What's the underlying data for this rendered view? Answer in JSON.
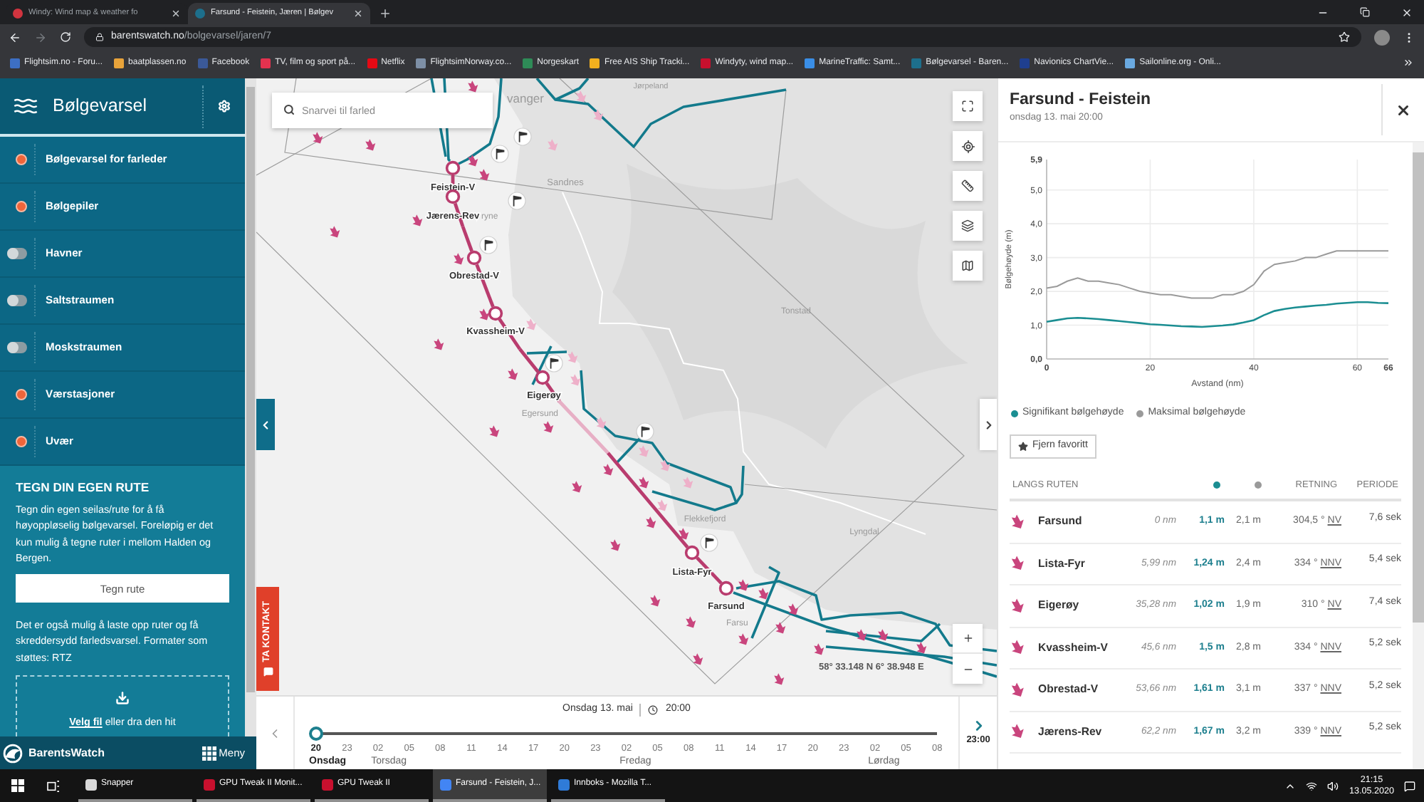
{
  "browser": {
    "tabs": [
      {
        "title": "Windy: Wind map & weather fo",
        "selected": false,
        "color": "#d1343f"
      },
      {
        "title": "Farsund - Feistein, Jæren | Bølgev",
        "selected": true,
        "color": "#1d6f8c"
      }
    ],
    "url": {
      "host": "barentswatch.no",
      "path": "/bolgevarsel/jaren/7"
    },
    "bookmarks": [
      {
        "label": "Flightsim.no - Foru...",
        "color": "#3d6fc4"
      },
      {
        "label": "baatplassen.no",
        "color": "#e8a33a"
      },
      {
        "label": "Facebook",
        "color": "#3b5998"
      },
      {
        "label": "TV, film og sport på...",
        "color": "#e3324f"
      },
      {
        "label": "Netflix",
        "color": "#e50914"
      },
      {
        "label": "FlightsimNorway.co...",
        "color": "#7d8fa6"
      },
      {
        "label": "Norgeskart",
        "color": "#2e8b57"
      },
      {
        "label": "Free AIS Ship Tracki...",
        "color": "#f2b01e"
      },
      {
        "label": "Windyty, wind map...",
        "color": "#c8102e"
      },
      {
        "label": "MarineTraffic: Samt...",
        "color": "#3a8ee6"
      },
      {
        "label": "Bølgevarsel - Baren...",
        "color": "#1d6f8c"
      },
      {
        "label": "Navionics ChartVie...",
        "color": "#1f3f8f"
      },
      {
        "label": "Sailonline.org - Onli...",
        "color": "#6aa9e0"
      }
    ]
  },
  "sidebar": {
    "title": "Bølgevarsel",
    "layers": [
      {
        "label": "Bølgevarsel for farleder",
        "on": true
      },
      {
        "label": "Bølgepiler",
        "on": true
      },
      {
        "label": "Havner",
        "on": false
      },
      {
        "label": "Saltstraumen",
        "on": false
      },
      {
        "label": "Moskstraumen",
        "on": false
      },
      {
        "label": "Værstasjoner",
        "on": true
      },
      {
        "label": "Uvær",
        "on": true
      }
    ],
    "route": {
      "heading": "TEGN DIN EGEN RUTE",
      "text": "Tegn din egen seilas/rute for å få høyoppløselig bølgevarsel. Foreløpig er det kun mulig å tegne ruter i mellom Halden og Bergen.",
      "button": "Tegn rute",
      "upload_text": "Det er også mulig å laste opp ruter og få skreddersydd farledsvarsel. Formater som støttes: RTZ",
      "drop": {
        "link": "Velg fil",
        "text": "eller dra den hit"
      }
    },
    "footer": {
      "brand": "BarentsWatch",
      "menu": "Meny"
    }
  },
  "map": {
    "search_placeholder": "Snarvei til farled",
    "places": [
      {
        "name": "Jørpeland"
      },
      {
        "name": "vanger"
      },
      {
        "name": "Sandnes"
      },
      {
        "name": "ryne"
      },
      {
        "name": "Tonstad"
      },
      {
        "name": "Egersund"
      },
      {
        "name": "Flekkefjord"
      },
      {
        "name": "Lyngdal"
      },
      {
        "name": "Farsu"
      }
    ],
    "stations": [
      {
        "name": "Feistein-V"
      },
      {
        "name": "Jærens-Rev"
      },
      {
        "name": "Obrestad-V"
      },
      {
        "name": "Kvassheim-V"
      },
      {
        "name": "Eigerøy"
      },
      {
        "name": "Lista-Fyr"
      },
      {
        "name": "Farsund"
      }
    ],
    "coordinates": "58° 33.148 N 6° 38.948 E",
    "contact": "TA KONTAKT"
  },
  "timeline": {
    "date": "Onsdag 13. mai",
    "time": "20:00",
    "level": 0,
    "hours": [
      {
        "label": "20",
        "day": "Onsdag",
        "selected": true
      },
      {
        "label": "23",
        "selected": false
      },
      {
        "label": "02",
        "day": "Torsdag",
        "selected": false
      },
      {
        "label": "05",
        "selected": false
      },
      {
        "label": "08",
        "selected": false
      },
      {
        "label": "11",
        "selected": false
      },
      {
        "label": "14",
        "selected": false
      },
      {
        "label": "17",
        "selected": false
      },
      {
        "label": "20",
        "selected": false
      },
      {
        "label": "23",
        "selected": false
      },
      {
        "label": "02",
        "day": "Fredag",
        "selected": false
      },
      {
        "label": "05",
        "selected": false
      },
      {
        "label": "08",
        "selected": false
      },
      {
        "label": "11",
        "selected": false
      },
      {
        "label": "14",
        "selected": false
      },
      {
        "label": "17",
        "selected": false
      },
      {
        "label": "20",
        "selected": false
      },
      {
        "label": "23",
        "selected": false
      },
      {
        "label": "02",
        "day": "Lørdag",
        "selected": false
      },
      {
        "label": "05",
        "selected": false
      },
      {
        "label": "08",
        "selected": false
      }
    ],
    "end_time": "23:00"
  },
  "panel": {
    "title": "Farsund - Feistein",
    "subtitle": "onsdag 13. mai 20:00",
    "chart_data": {
      "type": "line",
      "xlabel": "Avstand (nm)",
      "ylabel": "Bølgehøyde (m)",
      "x": [
        0,
        2,
        4,
        6,
        8,
        10,
        12,
        14,
        16,
        18,
        20,
        22,
        24,
        26,
        28,
        30,
        32,
        34,
        36,
        38,
        40,
        42,
        44,
        46,
        48,
        50,
        52,
        54,
        56,
        58,
        60,
        62,
        64,
        66
      ],
      "series": [
        {
          "name": "Signifikant bølgehøyde",
          "color": "#1b8e92",
          "values": [
            1.1,
            1.15,
            1.2,
            1.22,
            1.2,
            1.18,
            1.15,
            1.12,
            1.09,
            1.06,
            1.03,
            1.01,
            0.99,
            0.97,
            0.96,
            0.95,
            0.97,
            0.99,
            1.02,
            1.08,
            1.15,
            1.3,
            1.42,
            1.48,
            1.52,
            1.55,
            1.58,
            1.6,
            1.64,
            1.66,
            1.68,
            1.68,
            1.66,
            1.65
          ]
        },
        {
          "name": "Maksimal bølgehøyde",
          "color": "#9a9a9a",
          "values": [
            2.1,
            2.15,
            2.3,
            2.4,
            2.3,
            2.3,
            2.25,
            2.2,
            2.1,
            2.0,
            1.95,
            1.9,
            1.9,
            1.85,
            1.8,
            1.8,
            1.8,
            1.9,
            1.9,
            2.0,
            2.2,
            2.6,
            2.8,
            2.85,
            2.9,
            3.0,
            3.0,
            3.1,
            3.2,
            3.2,
            3.2,
            3.2,
            3.2,
            3.2
          ]
        }
      ],
      "xlim": [
        0,
        66
      ],
      "ylim": [
        0,
        5.9
      ],
      "xticks": [
        0,
        20,
        40,
        60,
        66
      ],
      "yticks": [
        {
          "value": 0,
          "label": "0,0"
        },
        {
          "value": 1,
          "label": "1,0"
        },
        {
          "value": 2,
          "label": "2,0"
        },
        {
          "value": 3,
          "label": "3,0"
        },
        {
          "value": 4,
          "label": "4,0"
        },
        {
          "value": 5,
          "label": "5,0"
        },
        {
          "value": 5.9,
          "label": "5,9"
        }
      ],
      "grid": true
    },
    "favorite_button": "Fjern favoritt",
    "table": {
      "columns": [
        {
          "kind": "text",
          "label": "LANGS RUTEN"
        },
        {
          "kind": "dot",
          "color": "#1b8e92"
        },
        {
          "kind": "dot",
          "color": "#9a9a9a"
        },
        {
          "kind": "text",
          "label": "RETNING"
        },
        {
          "kind": "text",
          "label": "PERIODE"
        }
      ],
      "rows": [
        {
          "name": "Farsund",
          "distance": "0 nm",
          "significant": "1,1 m",
          "maximum": "2,1 m",
          "degrees": "304,5 °",
          "direction": "NV",
          "period": "7,6 sek"
        },
        {
          "name": "Lista-Fyr",
          "distance": "5,99 nm",
          "significant": "1,24 m",
          "maximum": "2,4 m",
          "degrees": "334 °",
          "direction": "NNV",
          "period": "5,4 sek"
        },
        {
          "name": "Eigerøy",
          "distance": "35,28 nm",
          "significant": "1,02 m",
          "maximum": "1,9 m",
          "degrees": "310 °",
          "direction": "NV",
          "period": "7,4 sek"
        },
        {
          "name": "Kvassheim-V",
          "distance": "45,6 nm",
          "significant": "1,5 m",
          "maximum": "2,8 m",
          "degrees": "334 °",
          "direction": "NNV",
          "period": "5,2 sek"
        },
        {
          "name": "Obrestad-V",
          "distance": "53,66 nm",
          "significant": "1,61 m",
          "maximum": "3,1 m",
          "degrees": "337 °",
          "direction": "NNV",
          "period": "5,2 sek"
        },
        {
          "name": "Jærens-Rev",
          "distance": "62,2 nm",
          "significant": "1,67 m",
          "maximum": "3,2 m",
          "degrees": "339 °",
          "direction": "NNV",
          "period": "5,2 sek"
        }
      ]
    }
  },
  "taskbar": {
    "apps": [
      {
        "label": "Snapper",
        "selected": false,
        "color": "#d8d8d8"
      },
      {
        "label": "GPU Tweak II Monit...",
        "selected": false,
        "color": "#c8102e"
      },
      {
        "label": "GPU Tweak II",
        "selected": false,
        "color": "#c8102e"
      },
      {
        "label": "Farsund - Feistein, J...",
        "selected": true,
        "color": "#4285f4"
      },
      {
        "label": "Innboks - Mozilla T...",
        "selected": false,
        "color": "#2f7bd8"
      }
    ],
    "time": "21:15",
    "date": "13.05.2020"
  }
}
